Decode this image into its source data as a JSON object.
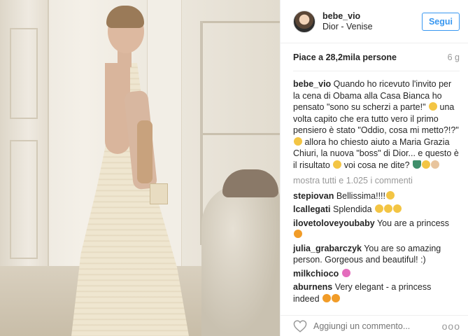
{
  "post": {
    "username": "bebe_vio",
    "location": "Dior - Venise",
    "follow_label": "Segui",
    "likes_text": "Piace a 28,2mila persone",
    "age": "6 g"
  },
  "caption": {
    "username": "bebe_vio",
    "text": "Quando ho ricevuto l'invito per la cena di Obama alla Casa Bianca ho pensato \"sono su scherzi a parte!\"",
    "text2": "una volta capito che era tutto vero il primo pensiero è stato \"Oddio, cosa mi metto?!?\"",
    "text3": "allora ho chiesto aiuto a Maria Grazia Chiuri, la nuova \"boss\" di Dior... e questo è il risultato",
    "text4": "voi cosa ne dite?"
  },
  "show_all": "mostra tutti e 1.025 i commenti",
  "comments": [
    {
      "user": "stepiovan",
      "text": "Bellissima!!!!"
    },
    {
      "user": "lcallegati",
      "text": "Splendida"
    },
    {
      "user": "ilovetoloveyoubaby",
      "text": "You are a princess"
    },
    {
      "user": "julia_grabarczyk",
      "text": "You are so amazing person. Gorgeous and beautiful! :)"
    },
    {
      "user": "milkchioco",
      "text": ""
    },
    {
      "user": "aburnens",
      "text": "Very elegant - a princess indeed"
    }
  ],
  "footer": {
    "comment_placeholder": "Aggiungi un commento...",
    "more": "ooo"
  },
  "icons": [
    "heart-icon",
    "more-icon",
    "avatar"
  ],
  "colors": {
    "accent": "#3897f0",
    "muted": "#999999",
    "text": "#262626"
  }
}
